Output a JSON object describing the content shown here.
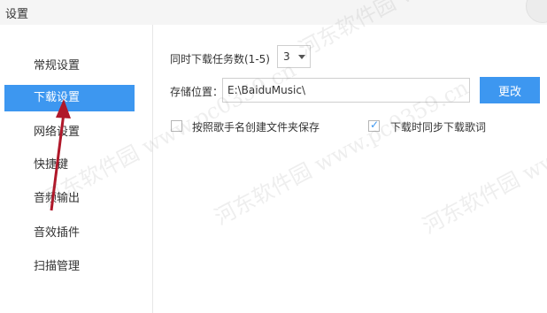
{
  "window": {
    "title": "设置"
  },
  "sidebar": {
    "items": [
      {
        "label": "常规设置",
        "active": false
      },
      {
        "label": "下载设置",
        "active": true
      },
      {
        "label": "网络设置",
        "active": false
      },
      {
        "label": "快捷键",
        "active": false
      },
      {
        "label": "音频输出",
        "active": false
      },
      {
        "label": "音效插件",
        "active": false
      },
      {
        "label": "扫描管理",
        "active": false
      }
    ]
  },
  "download": {
    "task_count_label": "同时下载任务数(1-5)",
    "task_count_value": "3",
    "storage_label": "存储位置：",
    "storage_path": "E:\\BaiduMusic\\",
    "change_button": "更改",
    "options": [
      {
        "label": "按照歌手名创建文件夹保存",
        "checked": false
      },
      {
        "label": "下载时同步下载歌词",
        "checked": true
      }
    ]
  },
  "watermark": {
    "text": "河东软件园 www.pc0359.cn"
  },
  "colors": {
    "accent": "#3d97f0",
    "annotation_arrow": "#b0182a"
  }
}
